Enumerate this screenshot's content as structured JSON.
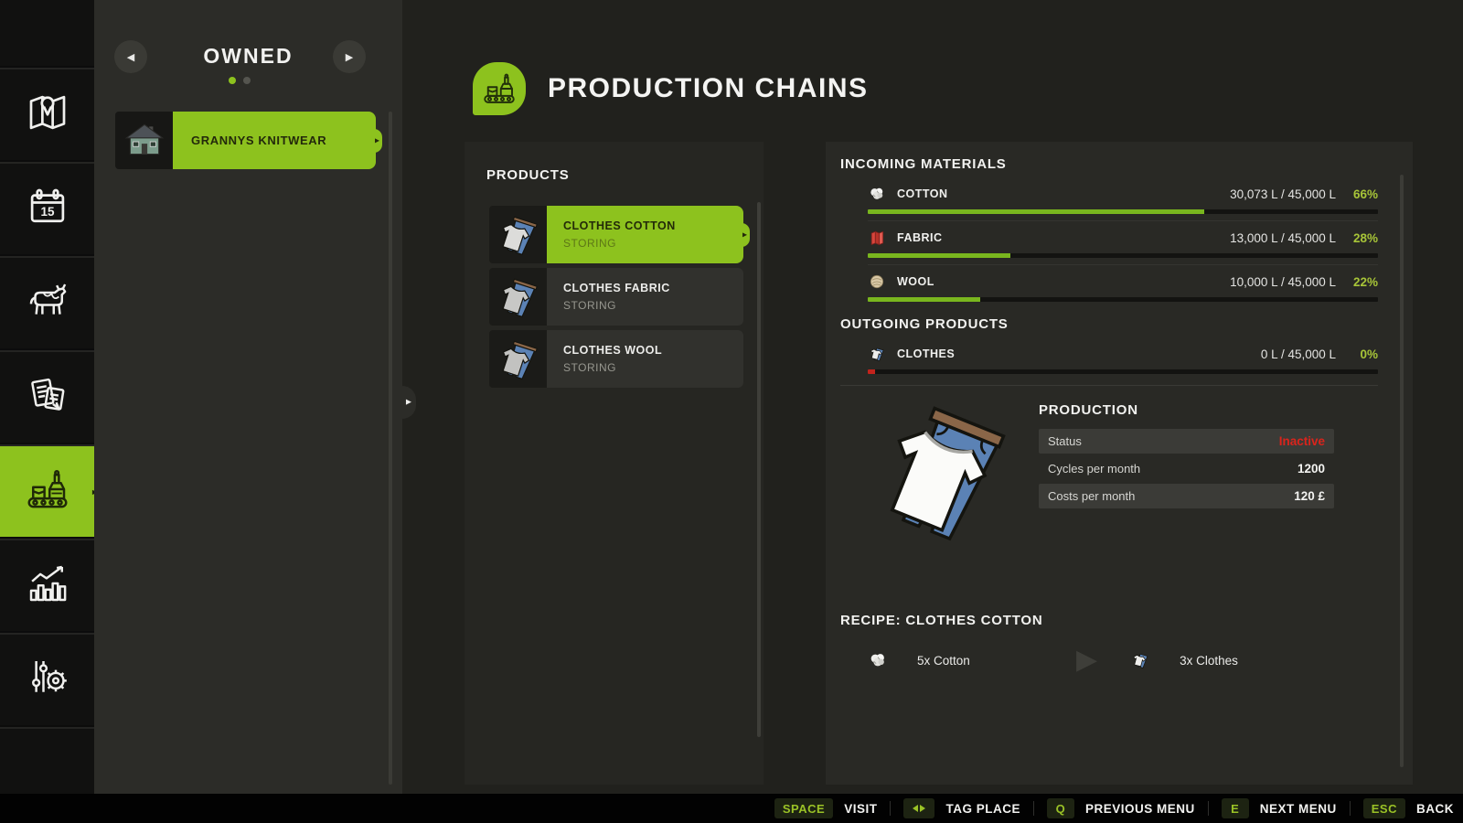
{
  "colors": {
    "accent_green": "#8dc21e",
    "bar_green": "#79b61e",
    "percent_green": "#a7c438",
    "status_red": "#da241c",
    "empty_red": "#c2231c"
  },
  "sidebar": {
    "icons": [
      "map",
      "calendar",
      "animals",
      "contracts",
      "production-chains",
      "statistics",
      "settings"
    ],
    "active": "production-chains"
  },
  "owned": {
    "title": "OWNED",
    "prev_arrow": "◀",
    "next_arrow": "▶",
    "pages": 2,
    "active_page": 1,
    "item": {
      "name": "GRANNYS KNITWEAR",
      "arrow": "▸"
    }
  },
  "header": {
    "title": "PRODUCTION CHAINS"
  },
  "products": {
    "title": "PRODUCTS",
    "items": [
      {
        "name": "CLOTHES COTTON",
        "status": "STORING",
        "selected": true,
        "arrow": "▸"
      },
      {
        "name": "CLOTHES FABRIC",
        "status": "STORING",
        "selected": false
      },
      {
        "name": "CLOTHES WOOL",
        "status": "STORING",
        "selected": false
      }
    ]
  },
  "incoming": {
    "title": "INCOMING MATERIALS",
    "rows": [
      {
        "name": "COTTON",
        "icon": "cotton-icon",
        "amount": "30,073 L / 45,000 L",
        "percent": "66%",
        "fill": 66
      },
      {
        "name": "FABRIC",
        "icon": "fabric-icon",
        "amount": "13,000 L / 45,000 L",
        "percent": "28%",
        "fill": 28
      },
      {
        "name": "WOOL",
        "icon": "wool-icon",
        "amount": "10,000 L / 45,000 L",
        "percent": "22%",
        "fill": 22
      }
    ]
  },
  "outgoing": {
    "title": "OUTGOING PRODUCTS",
    "rows": [
      {
        "name": "CLOTHES",
        "icon": "clothes-icon",
        "amount": "0 L / 45,000 L",
        "percent": "0%",
        "fill": 0
      }
    ]
  },
  "production": {
    "title": "PRODUCTION",
    "rows": [
      {
        "label": "Status",
        "value": "Inactive"
      },
      {
        "label": "Cycles per month",
        "value": "1200"
      },
      {
        "label": "Costs per month",
        "value": "120 £"
      }
    ]
  },
  "recipe": {
    "title": "RECIPE: CLOTHES COTTON",
    "input": {
      "icon": "cotton-icon",
      "text": "5x Cotton"
    },
    "arrow": "▶",
    "output": {
      "icon": "clothes-icon",
      "text": "3x Clothes"
    }
  },
  "bottom_bar": {
    "hints": [
      {
        "key": "SPACE",
        "label": "VISIT"
      },
      {
        "key": "tab-icon",
        "label": "TAG PLACE"
      },
      {
        "key": "Q",
        "label": "PREVIOUS MENU"
      },
      {
        "key": "E",
        "label": "NEXT MENU"
      },
      {
        "key": "ESC",
        "label": "BACK"
      }
    ]
  },
  "chart_data": {
    "type": "bar",
    "title": "Storage fill levels",
    "categories": [
      "Cotton",
      "Fabric",
      "Wool",
      "Clothes"
    ],
    "values": [
      30073,
      13000,
      10000,
      0
    ],
    "capacity": 45000,
    "percentages": [
      66,
      28,
      22,
      0
    ],
    "unit": "L"
  }
}
